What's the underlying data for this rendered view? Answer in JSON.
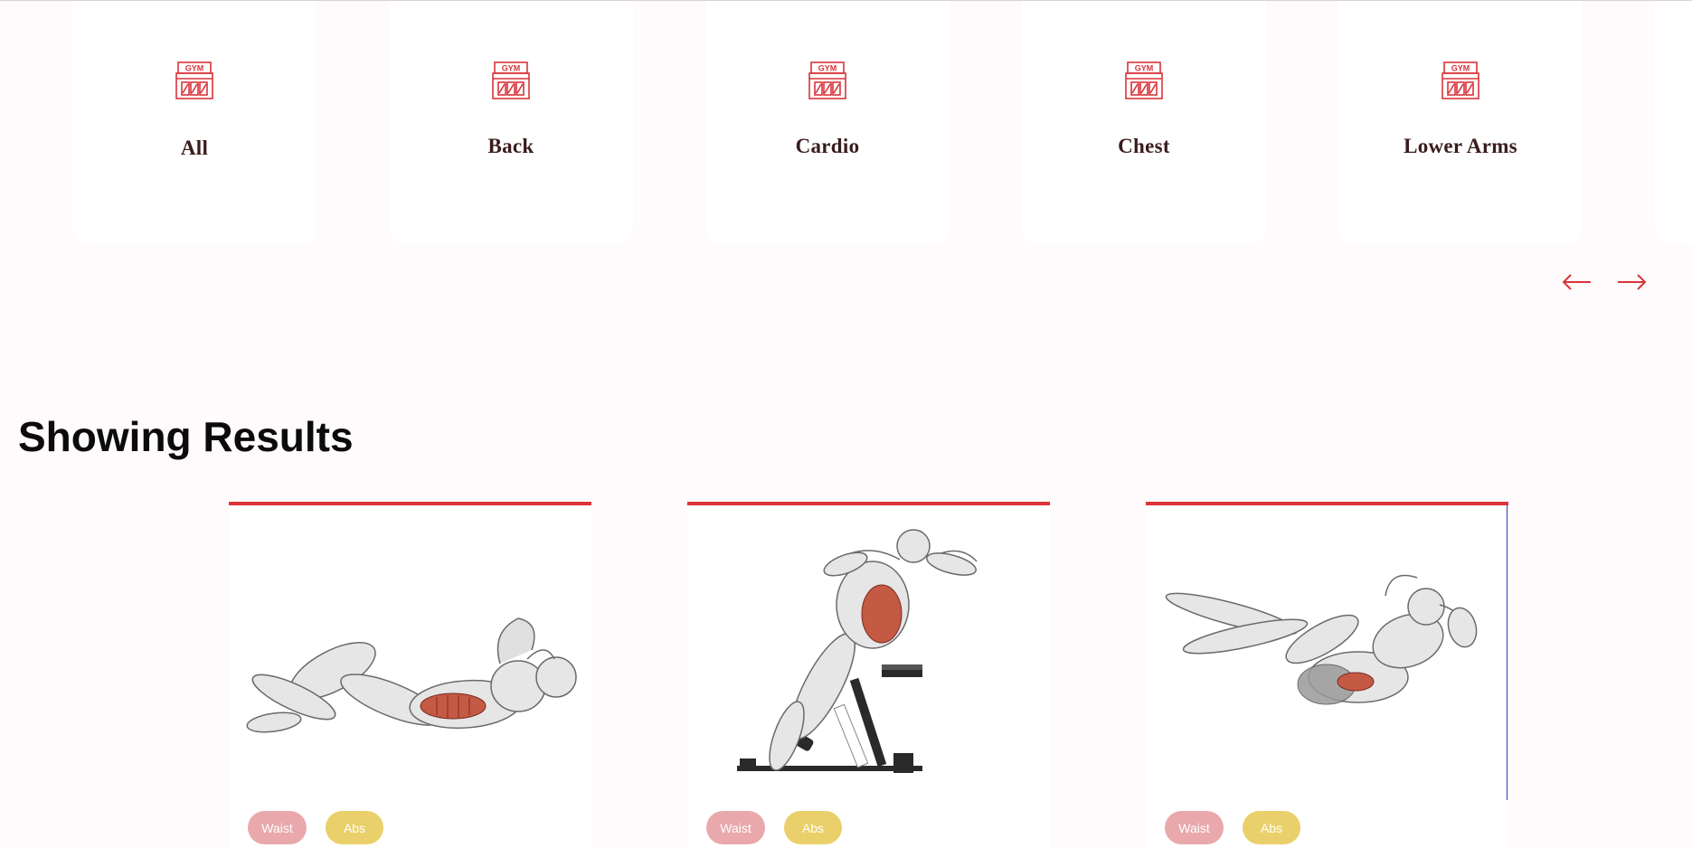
{
  "categories": {
    "icon_text": "GYM",
    "items": [
      {
        "label": "All"
      },
      {
        "label": "Back"
      },
      {
        "label": "Cardio"
      },
      {
        "label": "Chest"
      },
      {
        "label": "Lower Arms"
      },
      {
        "label": ""
      }
    ],
    "prev_icon": "arrow-left-icon",
    "next_icon": "arrow-right-icon"
  },
  "results": {
    "title": "Showing Results",
    "cards": [
      {
        "image": "crunch-exercise-illustration",
        "body_part": "Waist",
        "target": "Abs"
      },
      {
        "image": "decline-situp-exercise-illustration",
        "body_part": "Waist",
        "target": "Abs"
      },
      {
        "image": "v-up-exercise-illustration",
        "body_part": "Waist",
        "target": "Abs"
      }
    ]
  },
  "colors": {
    "accent": "#dc3438",
    "body_tag": "#e9a9ac",
    "target_tag": "#ead06a",
    "background": "#fffafb"
  }
}
